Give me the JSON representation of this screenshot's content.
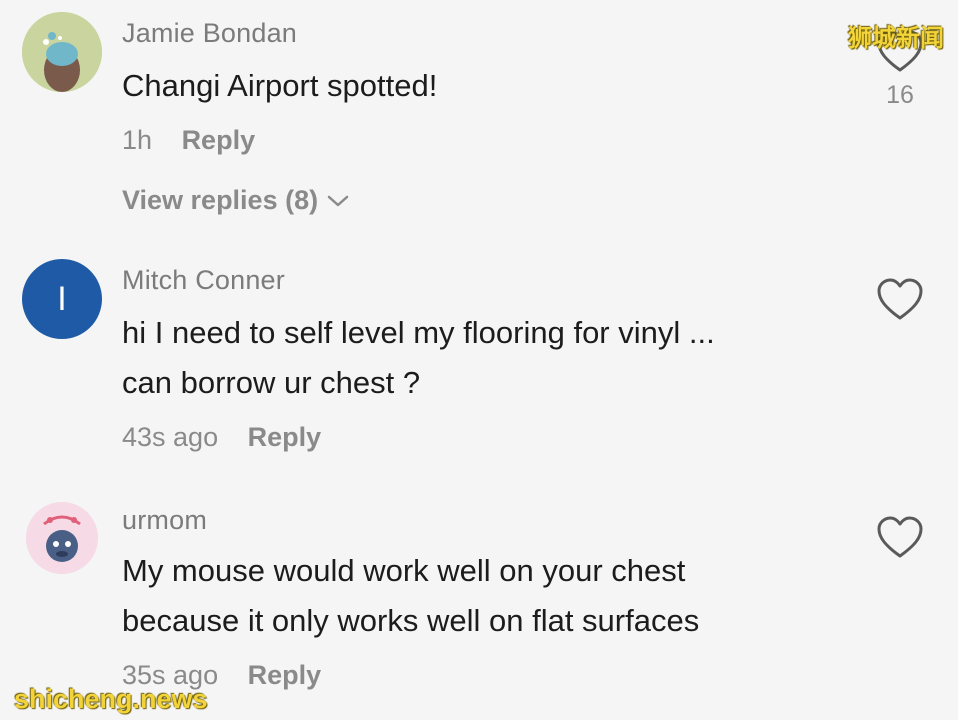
{
  "watermarks": {
    "top": "狮城新闻",
    "bottom": "shicheng.news"
  },
  "comments": [
    {
      "author": "Jamie Bondan",
      "text": "Changi Airport spotted!",
      "time": "1h",
      "reply_label": "Reply",
      "view_replies": "View replies (8)",
      "likes": "16",
      "avatar_color": "#c9d49e"
    },
    {
      "author": "Mitch Conner",
      "text": "hi I need to self level my flooring for vinyl ...\ncan borrow ur chest ?",
      "time": "43s ago",
      "reply_label": "Reply",
      "avatar_letter": "I",
      "avatar_color": "#1f5aa6"
    },
    {
      "author": "urmom",
      "text": "My mouse would work well on your chest\nbecause it only works well on flat surfaces",
      "time": "35s ago",
      "reply_label": "Reply",
      "avatar_color": "#f6dbe6"
    }
  ],
  "icons": {
    "like": "heart-outline-icon",
    "expand": "chevron-down-icon"
  }
}
